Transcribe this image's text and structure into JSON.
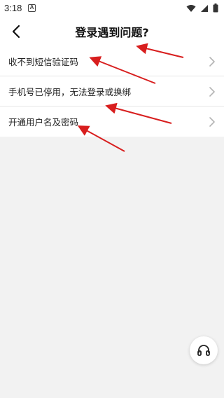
{
  "status_bar": {
    "time": "3:18",
    "app_icon": "A"
  },
  "header": {
    "title": "登录遇到问题?"
  },
  "list": {
    "items": [
      {
        "label": "收不到短信验证码"
      },
      {
        "label": "手机号已停用，无法登录或换绑"
      },
      {
        "label": "开通用户名及密码"
      }
    ]
  },
  "colors": {
    "background": "#f2f2f2",
    "card": "#ffffff",
    "annotation_arrow": "#d81e1e",
    "chevron": "#b5b5b5"
  },
  "icons": {
    "back": "back-arrow-icon",
    "chevron": "chevron-right-icon",
    "support": "headphones-icon",
    "wifi": "wifi-icon",
    "signal": "signal-icon",
    "battery": "battery-icon"
  }
}
